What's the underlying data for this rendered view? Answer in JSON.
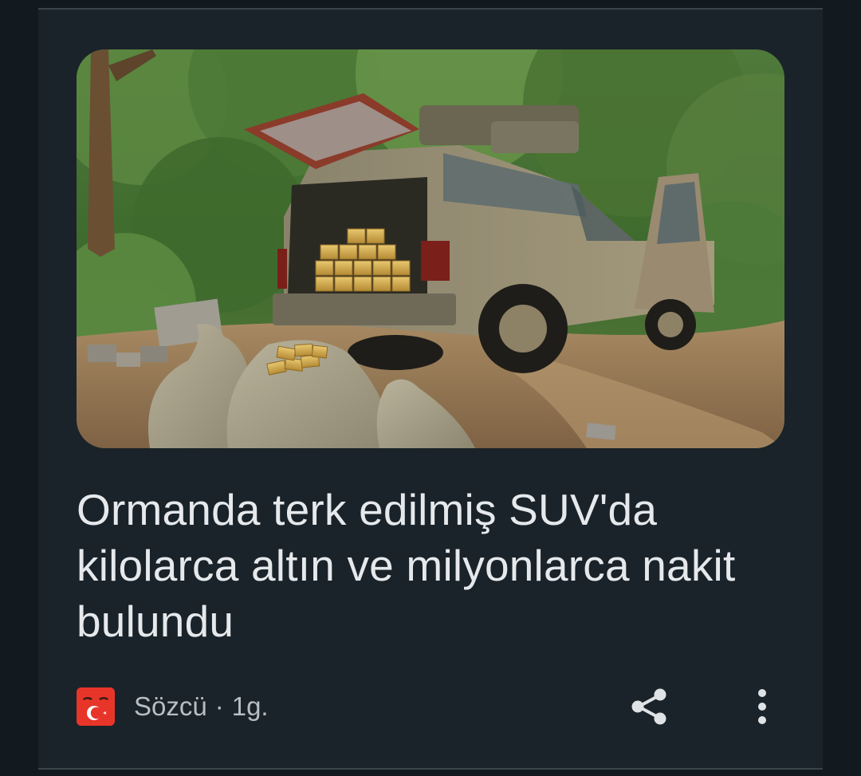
{
  "article": {
    "headline": "Ormanda terk edilmiş SUV'da kilolarca altın ve milyonlarca nakit bulundu",
    "image_alt": "Abandoned muddy SUV in a forest with gold bars in the trunk and sacks of gold on the ground"
  },
  "source": {
    "name": "Sözcü",
    "separator": "·",
    "age": "1g.",
    "logo_color": "#e8352a"
  },
  "actions": {
    "share_icon": "share-icon",
    "more_icon": "more-vert-icon"
  },
  "colors": {
    "background": "#121a1f",
    "card": "#1a2329",
    "headline": "#e6e9ec",
    "meta": "#b7bec4"
  }
}
